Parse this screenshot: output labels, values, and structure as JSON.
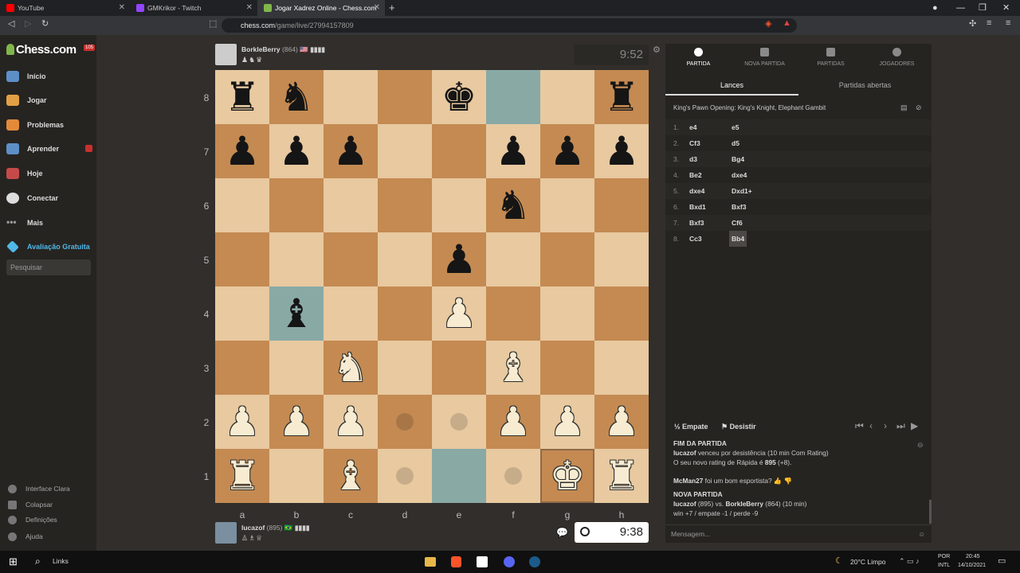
{
  "browser": {
    "tabs": [
      {
        "title": "YouTube",
        "color": "#ff0000"
      },
      {
        "title": "GMKrikor - Twitch",
        "color": "#9146ff"
      },
      {
        "title": "Jogar Xadrez Online - Chess.com",
        "color": "#81b64c"
      }
    ],
    "url_host": "chess.com",
    "url_path": "/game/live/27994157809"
  },
  "sidebar": {
    "logo": "Chess.com",
    "logo_badge": "105",
    "items": [
      {
        "label": "Início",
        "color": "#5d8fc7"
      },
      {
        "label": "Jogar",
        "color": "#e2a045"
      },
      {
        "label": "Problemas",
        "color": "#e38a3a"
      },
      {
        "label": "Aprender",
        "color": "#5d8fc7"
      },
      {
        "label": "Hoje",
        "color": "#c74a4a"
      },
      {
        "label": "Conectar",
        "color": "#dddddd"
      },
      {
        "label": "Mais",
        "color": "#999999"
      },
      {
        "label": "Avaliação Gratuita",
        "color": "#4fb8e8"
      }
    ],
    "search_placeholder": "Pesquisar",
    "bottom": [
      "Interface Clara",
      "Colapsar",
      "Definições",
      "Ajuda"
    ]
  },
  "players": {
    "top": {
      "name": "BorkleBerry",
      "rating": "(864)",
      "flag": "🇺🇸",
      "clock": "9:52",
      "captured": "♟♞♛"
    },
    "bottom": {
      "name": "lucazof",
      "rating": "(895)",
      "flag": "🇧🇷",
      "clock": "9:38",
      "captured": "♙♗♕"
    }
  },
  "board": {
    "files": [
      "a",
      "b",
      "c",
      "d",
      "e",
      "f",
      "g",
      "h"
    ],
    "ranks": [
      "8",
      "7",
      "6",
      "5",
      "4",
      "3",
      "2",
      "1"
    ],
    "position": [
      [
        "r",
        "n",
        "",
        "",
        "k",
        "",
        "",
        "r"
      ],
      [
        "p",
        "p",
        "p",
        "",
        "",
        "p",
        "p",
        "p"
      ],
      [
        "",
        "",
        "",
        "",
        "",
        "n",
        "",
        ""
      ],
      [
        "",
        "",
        "",
        "",
        "p",
        "",
        "",
        ""
      ],
      [
        "",
        "b",
        "",
        "",
        "P",
        "",
        "",
        ""
      ],
      [
        "",
        "",
        "N",
        "",
        "",
        "B",
        "",
        ""
      ],
      [
        "P",
        "P",
        "P",
        "",
        "",
        "P",
        "P",
        "P"
      ],
      [
        "R",
        "",
        "B",
        "",
        "",
        "",
        "K",
        "R"
      ]
    ],
    "highlight": [
      "f8",
      "b4",
      "e1"
    ],
    "dots": [
      "d2",
      "e2",
      "d1",
      "f1"
    ],
    "selected": [
      "g1"
    ]
  },
  "panel": {
    "tabs": [
      "PARTIDA",
      "NOVA PARTIDA",
      "PARTIDAS",
      "JOGADORES"
    ],
    "subtabs": [
      "Lances",
      "Partidas abertas"
    ],
    "opening": "King's Pawn Opening: King's Knight, Elephant Gambit",
    "moves": [
      {
        "n": "1.",
        "w": "e4",
        "b": "e5"
      },
      {
        "n": "2.",
        "w": "Cf3",
        "b": "d5"
      },
      {
        "n": "3.",
        "w": "d3",
        "b": "Bg4"
      },
      {
        "n": "4.",
        "w": "Be2",
        "b": "dxe4"
      },
      {
        "n": "5.",
        "w": "dxe4",
        "b": "Dxd1+"
      },
      {
        "n": "6.",
        "w": "Bxd1",
        "b": "Bxf3"
      },
      {
        "n": "7.",
        "w": "Bxf3",
        "b": "Cf6"
      },
      {
        "n": "8.",
        "w": "Cc3",
        "b": "Bb4"
      }
    ],
    "draw_label": "Empate",
    "resign_label": "Desistir",
    "chat": {
      "end_title": "FIM DA PARTIDA",
      "end_player": "lucazof",
      "end_text": " venceu por desistência (10 min Com Rating)",
      "rating_prefix": "O seu novo rating de Rápida é ",
      "rating_value": "895",
      "rating_suffix": " (+8).",
      "sportsman_user": "McMan27",
      "sportsman_text": " foi um bom esportista?",
      "new_title": "NOVA PARTIDA",
      "new_p1": "lucazof",
      "new_mid": " (895) vs. ",
      "new_p2": "BorkleBerry",
      "new_tail": " (864) (10 min)",
      "new_stakes": "win +7 / empate -1 / perde -9"
    },
    "message_placeholder": "Mensagem..."
  },
  "taskbar": {
    "links": "Links",
    "weather": "20°C  Limpo",
    "lang1": "POR",
    "lang2": "INTL",
    "time": "20:45",
    "date": "14/10/2021"
  }
}
